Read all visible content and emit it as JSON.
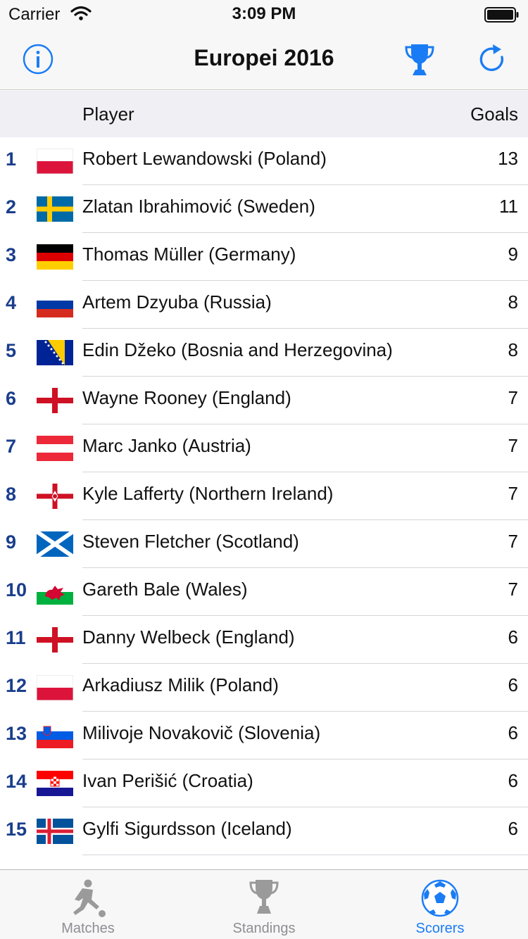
{
  "status": {
    "carrier": "Carrier",
    "time": "3:09 PM"
  },
  "nav": {
    "title": "Europei 2016"
  },
  "header": {
    "player": "Player",
    "goals": "Goals"
  },
  "scorers": [
    {
      "rank": "1",
      "player": "Robert Lewandowski (Poland)",
      "goals": "13",
      "flag": "poland"
    },
    {
      "rank": "2",
      "player": "Zlatan Ibrahimović (Sweden)",
      "goals": "11",
      "flag": "sweden"
    },
    {
      "rank": "3",
      "player": "Thomas Müller (Germany)",
      "goals": "9",
      "flag": "germany"
    },
    {
      "rank": "4",
      "player": "Artem Dzyuba (Russia)",
      "goals": "8",
      "flag": "russia"
    },
    {
      "rank": "5",
      "player": "Edin Džeko (Bosnia and Herzegovina)",
      "goals": "8",
      "flag": "bosnia"
    },
    {
      "rank": "6",
      "player": "Wayne Rooney (England)",
      "goals": "7",
      "flag": "england"
    },
    {
      "rank": "7",
      "player": "Marc Janko (Austria)",
      "goals": "7",
      "flag": "austria"
    },
    {
      "rank": "8",
      "player": "Kyle Lafferty (Northern Ireland)",
      "goals": "7",
      "flag": "northern-ireland"
    },
    {
      "rank": "9",
      "player": "Steven Fletcher (Scotland)",
      "goals": "7",
      "flag": "scotland"
    },
    {
      "rank": "10",
      "player": "Gareth Bale (Wales)",
      "goals": "7",
      "flag": "wales"
    },
    {
      "rank": "11",
      "player": "Danny Welbeck (England)",
      "goals": "6",
      "flag": "england"
    },
    {
      "rank": "12",
      "player": "Arkadiusz Milik (Poland)",
      "goals": "6",
      "flag": "poland"
    },
    {
      "rank": "13",
      "player": "Milivoje Novakovič (Slovenia)",
      "goals": "6",
      "flag": "slovenia"
    },
    {
      "rank": "14",
      "player": "Ivan Perišić (Croatia)",
      "goals": "6",
      "flag": "croatia"
    },
    {
      "rank": "15",
      "player": "Gylfi Sigurdsson (Iceland)",
      "goals": "6",
      "flag": "iceland"
    }
  ],
  "tabs": [
    {
      "label": "Matches",
      "icon": "football-player-icon",
      "active": false
    },
    {
      "label": "Standings",
      "icon": "trophy-icon",
      "active": false
    },
    {
      "label": "Scorers",
      "icon": "soccer-ball-icon",
      "active": true
    }
  ],
  "colors": {
    "accent": "#1a7cf5",
    "rank": "#1a3e8c",
    "inactive": "#8e8e93"
  }
}
